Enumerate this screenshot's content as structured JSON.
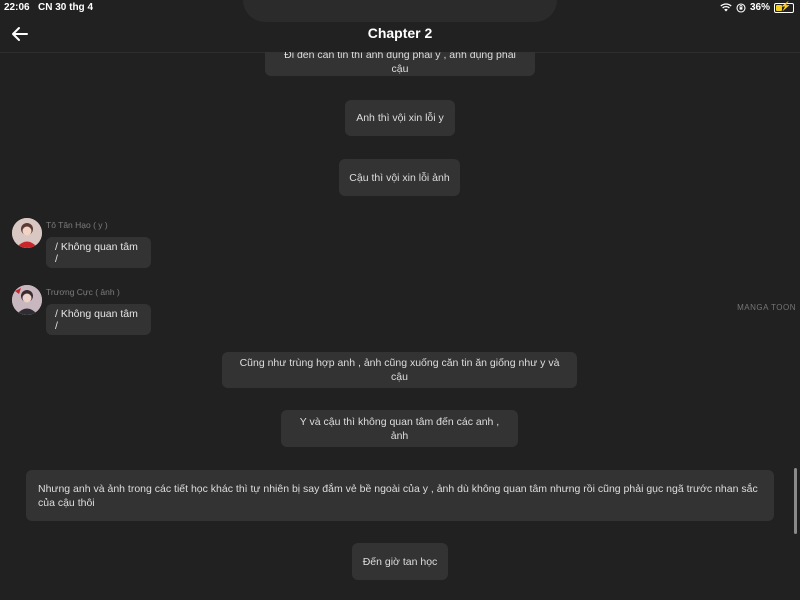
{
  "status": {
    "time": "22:06",
    "date": "CN 30 thg 4",
    "battery": "36%",
    "battery_level": 0.36,
    "icons": [
      "wifi-icon",
      "orientation-lock-icon",
      "battery-icon"
    ]
  },
  "header": {
    "title": "Chapter 2",
    "back_icon": "back-arrow-icon"
  },
  "messages": [
    {
      "type": "narration",
      "text": "Đi đến căn tin thì anh đụng phải y , ảnh đụng phải cậu"
    },
    {
      "type": "narration",
      "text": "Anh thì vội xin lỗi y"
    },
    {
      "type": "narration",
      "text": "Cậu thì vội xin lỗi ảnh"
    },
    {
      "type": "character",
      "name": "Tô Tân Hạo ( y )",
      "text": "/ Không quan tâm /"
    },
    {
      "type": "character",
      "name": "Trương Cực ( ảnh )",
      "text": "/ Không quan tâm /"
    },
    {
      "type": "narration",
      "text": "Cũng như trùng hợp anh , ảnh cũng xuống căn tin ăn giống như y và cậu"
    },
    {
      "type": "narration",
      "text": "Y và cậu thì không quan tâm đến các anh , ảnh"
    },
    {
      "type": "narration",
      "text": "Nhưng anh và ảnh trong các tiết học khác thì tự nhiên bị say đắm vẻ bề ngoài của y , ảnh dù không quan tâm nhưng rồi cũng phải gục ngã trước nhan sắc của cậu thôi"
    },
    {
      "type": "narration",
      "text": "Đến giờ tan học"
    }
  ],
  "watermark": "MANGA TOON"
}
